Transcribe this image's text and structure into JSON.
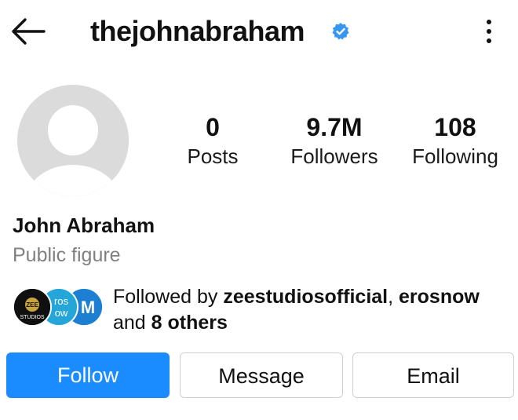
{
  "header": {
    "username": "thejohnabraham",
    "verified": true,
    "back_icon": "arrow-left-icon",
    "menu_icon": "more-vertical-icon"
  },
  "profile": {
    "avatar_icon": "default-avatar-icon",
    "display_name": "John Abraham",
    "category": "Public figure"
  },
  "stats": [
    {
      "value": "0",
      "label": "Posts"
    },
    {
      "value": "9.7M",
      "label": "Followers"
    },
    {
      "value": "108",
      "label": "Following"
    }
  ],
  "followed_by": {
    "prefix": "Followed by ",
    "account_1": "zeestudiosofficial",
    "separator": ", ",
    "account_2": "erosnow",
    "middle": "and ",
    "others": "8 others",
    "avatars": [
      {
        "name": "zee-studios-avatar",
        "line1": "ZEE",
        "line2": "STUDIOS"
      },
      {
        "name": "erosnow-avatar",
        "line1": "ros",
        "line2": "ow"
      },
      {
        "name": "third-follower-avatar",
        "line1": "M"
      }
    ]
  },
  "actions": {
    "follow_label": "Follow",
    "message_label": "Message",
    "email_label": "Email"
  },
  "colors": {
    "accent": "#1a8cff",
    "verified_badge": "#3797f0",
    "secondary_text": "#808080",
    "button_border": "#cfcfcf"
  }
}
